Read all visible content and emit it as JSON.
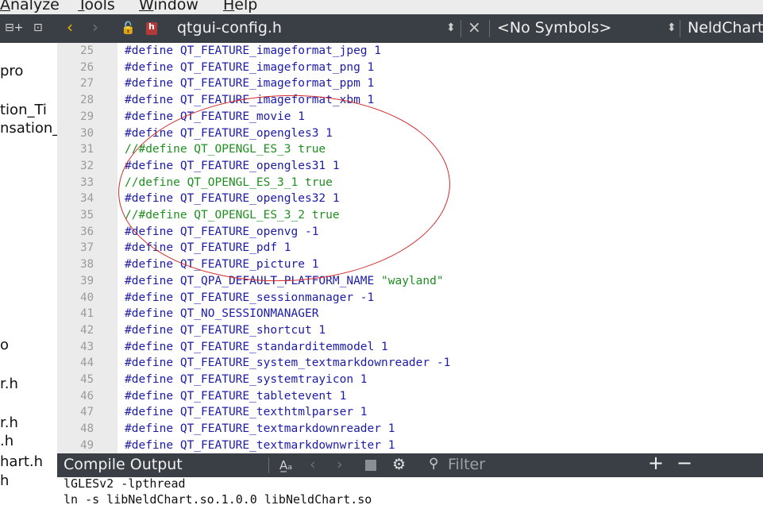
{
  "menu": [
    "Analyze",
    "Tools",
    "Window",
    "Help"
  ],
  "sidebar": {
    "files": [
      "pro",
      "tion_Ti",
      "nsation_",
      "o",
      "r.h",
      "r.h",
      ".h",
      "hart.h",
      "h"
    ]
  },
  "editor": {
    "file_name": "qtgui-config.h",
    "symbols": "<No Symbols>",
    "class_name": "NeldChart"
  },
  "code_lines": [
    {
      "n": 25,
      "text": "#define QT_FEATURE_imageformat_jpeg 1",
      "kind": "define"
    },
    {
      "n": 26,
      "text": "#define QT_FEATURE_imageformat_png 1",
      "kind": "define"
    },
    {
      "n": 27,
      "text": "#define QT_FEATURE_imageformat_ppm 1",
      "kind": "define"
    },
    {
      "n": 28,
      "text": "#define QT_FEATURE_imageformat_xbm 1",
      "kind": "define"
    },
    {
      "n": 29,
      "text": "#define QT_FEATURE_movie 1",
      "kind": "define"
    },
    {
      "n": 30,
      "text": "#define QT_FEATURE_opengles3 1",
      "kind": "define"
    },
    {
      "n": 31,
      "text": "//#define QT_OPENGL_ES_3 true",
      "kind": "comment"
    },
    {
      "n": 32,
      "text": "#define QT_FEATURE_opengles31 1",
      "kind": "define"
    },
    {
      "n": 33,
      "text": "//define QT_OPENGL_ES_3_1 true",
      "kind": "comment"
    },
    {
      "n": 34,
      "text": "#define QT_FEATURE_opengles32 1",
      "kind": "define"
    },
    {
      "n": 35,
      "text": "//#define QT_OPENGL_ES_3_2 true",
      "kind": "comment"
    },
    {
      "n": 36,
      "text": "#define QT_FEATURE_openvg -1",
      "kind": "define"
    },
    {
      "n": 37,
      "text": "#define QT_FEATURE_pdf 1",
      "kind": "define"
    },
    {
      "n": 38,
      "text": "#define QT_FEATURE_picture 1",
      "kind": "define"
    },
    {
      "n": 39,
      "text": "#define QT_QPA_DEFAULT_PLATFORM_NAME ",
      "str": "\"wayland\"",
      "kind": "define"
    },
    {
      "n": 40,
      "text": "#define QT_FEATURE_sessionmanager -1",
      "kind": "define"
    },
    {
      "n": 41,
      "text": "#define QT_NO_SESSIONMANAGER",
      "kind": "define"
    },
    {
      "n": 42,
      "text": "#define QT_FEATURE_shortcut 1",
      "kind": "define"
    },
    {
      "n": 43,
      "text": "#define QT_FEATURE_standarditemmodel 1",
      "kind": "define"
    },
    {
      "n": 44,
      "text": "#define QT_FEATURE_system_textmarkdownreader -1",
      "kind": "define"
    },
    {
      "n": 45,
      "text": "#define QT_FEATURE_systemtrayicon 1",
      "kind": "define"
    },
    {
      "n": 46,
      "text": "#define QT_FEATURE_tabletevent 1",
      "kind": "define"
    },
    {
      "n": 47,
      "text": "#define QT_FEATURE_texthtmlparser 1",
      "kind": "define"
    },
    {
      "n": 48,
      "text": "#define QT_FEATURE_textmarkdownreader 1",
      "kind": "define"
    },
    {
      "n": 49,
      "text": "#define QT_FEATURE_textmarkdownwriter 1",
      "kind": "define"
    }
  ],
  "output": {
    "title": "Compile Output",
    "filter_placeholder": "Filter",
    "lines": [
      "lGLESv2 -lpthread",
      "ln -s libNeldChart.so.1.0.0 libNeldChart.so"
    ]
  },
  "colors": {
    "toolbar_bg": "#3a3f45",
    "keyword": "#1c1ca8",
    "comment": "#1f8f1f",
    "annotation": "#d22a2a"
  }
}
